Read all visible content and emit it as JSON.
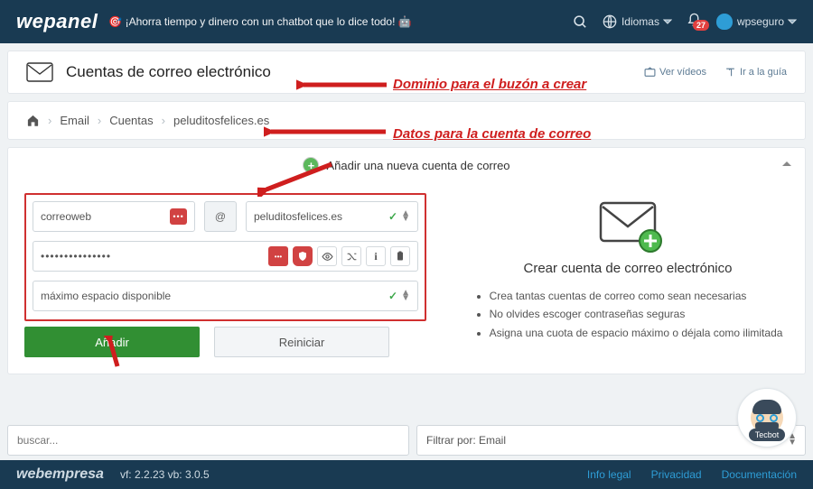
{
  "header": {
    "logo": "wepanel",
    "tagline": "🎯 ¡Ahorra tiempo y dinero con un chatbot que lo dice todo! 🤖",
    "language_label": "Idiomas",
    "user_label": "wpseguro",
    "notif_count": "27"
  },
  "title": {
    "heading": "Cuentas de correo electrónico",
    "videos": "Ver vídeos",
    "guide": "Ir a la guía"
  },
  "breadcrumbs": {
    "l1": "Email",
    "l2": "Cuentas",
    "l3": "peluditosfelices.es"
  },
  "group": {
    "heading": "Añadir una nueva cuenta de correo"
  },
  "form": {
    "user": "correoweb",
    "domain": "peluditosfelices.es",
    "password": "•••••••••••••••",
    "space": "máximo espacio disponible",
    "add_btn": "Añadir",
    "reset_btn": "Reiniciar"
  },
  "info": {
    "title": "Crear cuenta de correo electrónico",
    "b1": "Crea tantas cuentas de correo como sean necesarias",
    "b2": "No olvides escoger contraseñas seguras",
    "b3": "Asigna una cuota de espacio máximo o déjala como ilimitada"
  },
  "annotations": {
    "a1": "Dominio para el buzón a crear",
    "a2": "Datos para la cuenta de correo"
  },
  "bottom": {
    "search_ph": "buscar...",
    "filter": "Filtrar por: Email"
  },
  "footer": {
    "brand": "webempresa",
    "ver": "vf: 2.2.23 vb: 3.0.5",
    "l1": "Info legal",
    "l2": "Privacidad",
    "l3": "Documentación"
  },
  "tecbot": {
    "label": "Tecbot"
  }
}
